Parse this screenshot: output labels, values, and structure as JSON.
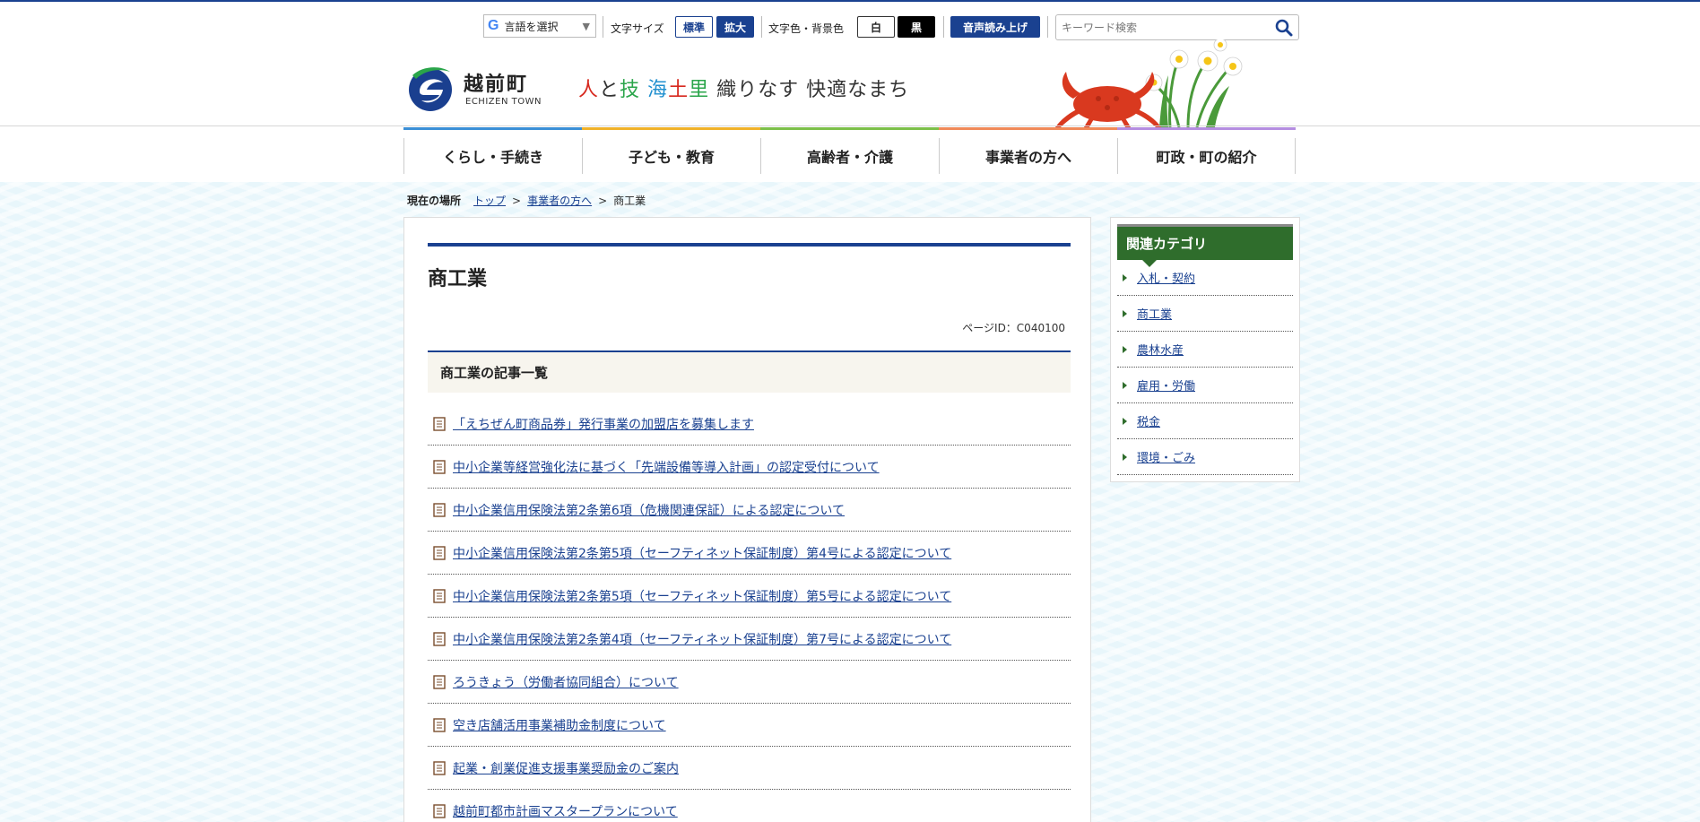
{
  "utility": {
    "language_label": "言語を選択",
    "font_size_label": "文字サイズ",
    "font_standard": "標準",
    "font_large": "拡大",
    "color_label": "文字色・背景色",
    "color_white": "白",
    "color_black": "黒",
    "speech_button": "音声読み上げ",
    "search_placeholder": "キーワード検索"
  },
  "logo": {
    "name": "越前町",
    "name_en": "ECHIZEN TOWN"
  },
  "catchphrase": {
    "parts": [
      {
        "text": "人",
        "color": "#d7281e"
      },
      {
        "text": "と",
        "color": "#333333"
      },
      {
        "text": "技",
        "color": "#2aa54a"
      },
      {
        "text": " ",
        "color": "#333333"
      },
      {
        "text": "海",
        "color": "#1f8fcf"
      },
      {
        "text": "土",
        "color": "#d7281e"
      },
      {
        "text": "里",
        "color": "#2aa54a"
      },
      {
        "text": " 織りなす 快適なまち",
        "color": "#333333"
      }
    ]
  },
  "nav": {
    "items": [
      "くらし・手続き",
      "子ども・教育",
      "高齢者・介護",
      "事業者の方へ",
      "町政・町の紹介"
    ],
    "colors": [
      "#3b8fd6",
      "#f0b22a",
      "#7cc04a",
      "#f08a5a",
      "#b58ee0"
    ]
  },
  "breadcrumb": {
    "here_label": "現在の場所",
    "top": "トップ",
    "business": "事業者の方へ",
    "current": "商工業",
    "sep": ">"
  },
  "main": {
    "title": "商工業",
    "page_id": "ページID：C040100",
    "list_heading": "商工業の記事一覧",
    "articles": [
      "「えちぜん町商品券」発行事業の加盟店を募集します",
      "中小企業等経営強化法に基づく「先端設備等導入計画」の認定受付について",
      "中小企業信用保険法第2条第6項（危機関連保証）による認定について",
      "中小企業信用保険法第2条第5項（セーフティネット保証制度）第4号による認定について",
      "中小企業信用保険法第2条第5項（セーフティネット保証制度）第5号による認定について",
      "中小企業信用保険法第2条第4項（セーフティネット保証制度）第7号による認定について",
      "ろうきょう（労働者協同組合）について",
      "空き店舗活用事業補助金制度について",
      "起業・創業促進支援事業奨励金のご案内",
      "越前町都市計画マスタープランについて"
    ]
  },
  "sidebar": {
    "heading": "関連カテゴリ",
    "items": [
      "入札・契約",
      "商工業",
      "農林水産",
      "雇用・労働",
      "税金",
      "環境・ごみ"
    ]
  },
  "colors": {
    "brand_blue": "#1a4190",
    "sidebar_green": "#2f6d2c",
    "background": "#e8f6fb"
  }
}
